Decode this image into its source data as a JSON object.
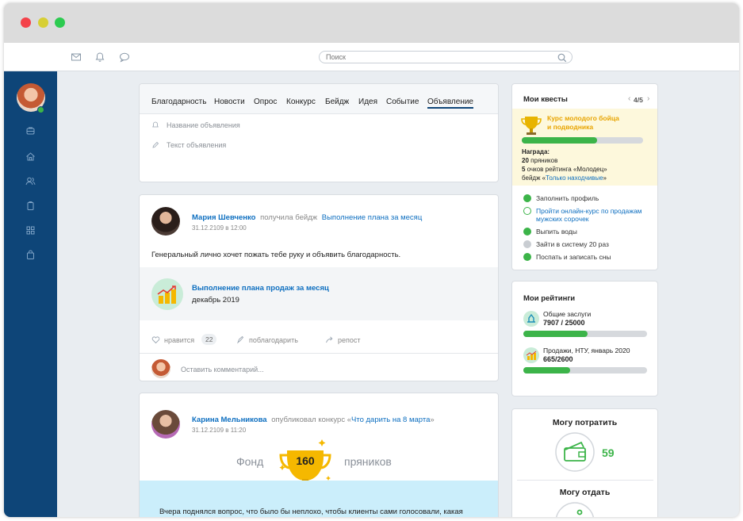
{
  "search": {
    "placeholder": "Поиск"
  },
  "composer": {
    "tabs": [
      "Благодарность",
      "Новости",
      "Опрос",
      "Конкурс",
      "Бейдж",
      "Идея",
      "Событие",
      "Объявление"
    ],
    "title_placeholder": "Название объявления",
    "text_placeholder": "Текст объявления"
  },
  "post1": {
    "author": "Мария Шевченко",
    "action": "получила бейдж",
    "badge_link": "Выполнение плана за месяц",
    "date": "31.12.2109 в 12:00",
    "text": "Генеральный лично хочет пожать тебе руку и объявить благодарность.",
    "badge_title": "Выполнение плана продаж за месяц",
    "badge_period": "декабрь 2019",
    "like_label": "нравится",
    "like_count": "22",
    "thank_label": "поблагодарить",
    "repost_label": "репост",
    "comment_placeholder": "Оставить комментарий..."
  },
  "post2": {
    "author": "Карина Мельникова",
    "action": "опубликовал конкурс «",
    "contest_link": "Что дарить на 8 марта",
    "action_end": "»",
    "date": "31.12.2109 в 11:20",
    "fund_label": "Фонд",
    "fund_value": "160",
    "fund_unit": "пряников",
    "text": "Вчера поднялся вопрос, что было бы неплохо, чтобы клиенты сами голосовали, какая"
  },
  "quests": {
    "title": "Мои квесты",
    "pager": "4/5",
    "course_line1": "Курс молодого бойца",
    "course_line2": "и подводника",
    "progress": 0.62,
    "reward_label": "Награда:",
    "reward_count": "20",
    "reward_item": " пряников",
    "reward_rating_count": "5",
    "reward_rating": " очков рейтинга «Молодец»",
    "reward_badge_prefix": "бейдж «",
    "reward_badge_link": "Только находчивые",
    "reward_badge_suffix": "»",
    "tasks": [
      {
        "label": "Заполнить профиль",
        "state": "done"
      },
      {
        "label": "Пройти онлайн-курс по продажам",
        "label2": "мужских сорочек",
        "state": "pending"
      },
      {
        "label": "Выпить воды",
        "state": "done"
      },
      {
        "label": "Зайти в систему 20 раз",
        "state": "locked"
      },
      {
        "label": "Поспать и записать сны",
        "state": "done"
      }
    ]
  },
  "ratings": {
    "title": "Мои рейтинги",
    "items": [
      {
        "name": "Общие заслуги",
        "value": "7907 / 25000",
        "progress": 0.52
      },
      {
        "name": "Продажи, НТУ, январь 2020",
        "value": "665/2600",
        "progress": 0.38
      }
    ]
  },
  "wallet": {
    "spend_title": "Могу потратить",
    "spend_value": "59",
    "give_title": "Могу отдать"
  },
  "colors": {
    "accent": "#0e4578",
    "link": "#0e6fc0",
    "green": "#3cb449",
    "gold": "#f5b800"
  }
}
